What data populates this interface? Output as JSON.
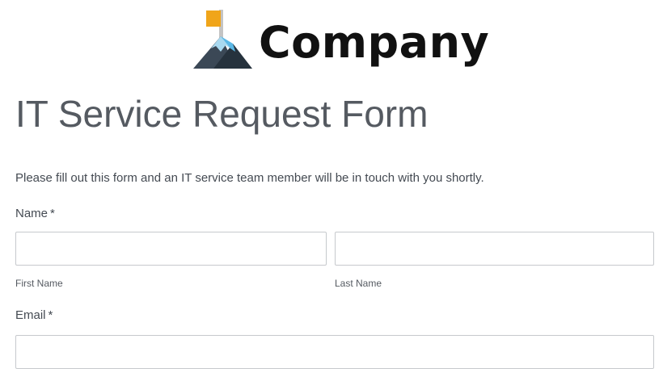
{
  "logo": {
    "text": "Company",
    "icon": "mountain-flag-icon",
    "colors": {
      "flag": "#f0a51a",
      "pole": "#c4c4c4",
      "mountain_dark": "#3b4856",
      "mountain_darker": "#26323d",
      "snow_light": "#a9d9f0",
      "snow_blue": "#5bb8e6"
    }
  },
  "form": {
    "title": "IT Service Request Form",
    "intro": "Please fill out this form and an IT service team member will be in touch with you shortly.",
    "name": {
      "label": "Name",
      "required_mark": "*",
      "first": {
        "value": "",
        "sublabel": "First Name"
      },
      "last": {
        "value": "",
        "sublabel": "Last Name"
      }
    },
    "email": {
      "label": "Email",
      "required_mark": "*",
      "value": ""
    }
  },
  "colors": {
    "text": "#444a52",
    "title": "#555a61",
    "input_border": "#c6c9cd"
  }
}
